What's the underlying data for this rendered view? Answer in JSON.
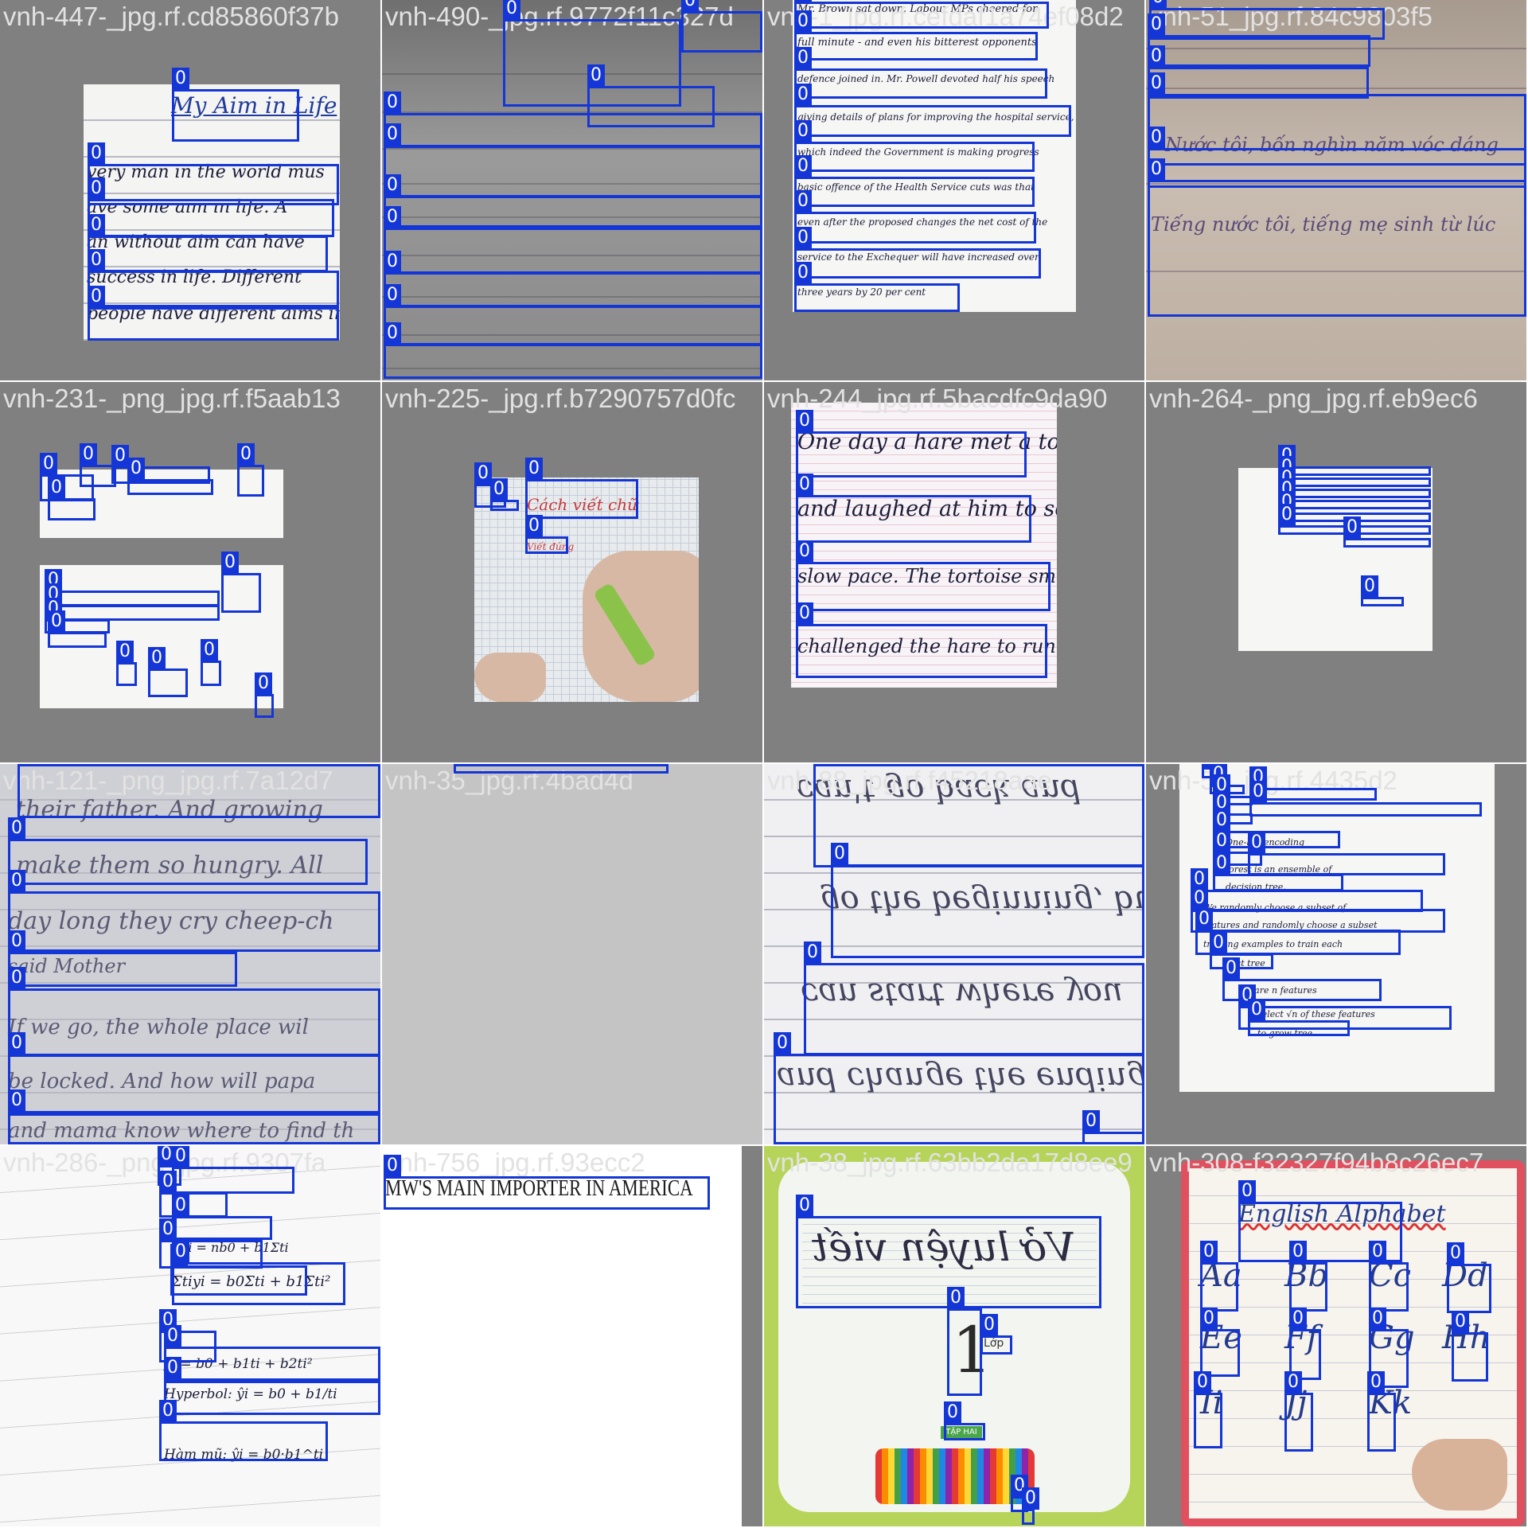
{
  "mosaic": {
    "class_label": "0",
    "tiles": [
      {
        "filename": "vnh-447-_jpg.rf.cd85860f37b",
        "title": "My Aim in Life",
        "lines": [
          "very man in the world mus",
          "ave some aim in life. A",
          "an without aim can have",
          "success in life. Different",
          "people have different aims in"
        ]
      },
      {
        "filename": "vnh-490-_jpg.rf.9772f11c327d",
        "lines": []
      },
      {
        "filename": "vnh-1_jpg.rf.cefdaf1a74ef08d2",
        "lines": [
          "Mr. Brown sat down. Labour MPs cheered for",
          "full minute - and even his bitterest opponents",
          "defence joined in. Mr. Powell devoted half his speech",
          "giving details of plans for improving the hospital service,",
          "which indeed the Government is making progress",
          "basic offence of the Health Service cuts was that",
          "even after the proposed changes the net cost of the",
          "service to the Exchequer will have increased over",
          "three years by 20 per cent"
        ]
      },
      {
        "filename": "vnh-51_jpg.rf.84c9803f5",
        "lines": [
          "Nước tôi, bốn nghìn năm vóc dáng",
          "Tiếng nước tôi, tiếng mẹ sinh từ lúc"
        ]
      },
      {
        "filename": "vnh-231-_png_jpg.rf.f5aab13",
        "lines": []
      },
      {
        "filename": "vnh-225-_jpg.rf.b7290757d0fc",
        "lines": [
          "Cách viết chữ",
          "Viết đúng"
        ]
      },
      {
        "filename": "vnh-244_jpg.rf.5bacdfc9da90",
        "lines": [
          "One day a hare met a tortoise",
          "and laughed at him to see his",
          "slow pace. The tortoise smiled and",
          "challenged the hare to run a race."
        ]
      },
      {
        "filename": "vnh-264-_png_jpg.rf.eb9ec6",
        "lines": []
      },
      {
        "filename": "vnh-121-_png_jpg.rf.7a12d7",
        "lines": [
          "their father. And growing",
          "make them so hungry. All",
          "day long they cry cheep-ch",
          "said Mother",
          "If we go, the whole place wil",
          "be locked. And how will papa",
          "and mama know where to find th"
        ]
      },
      {
        "filename": "vnh-35_jpg.rf.4bad4d",
        "lines": []
      },
      {
        "filename": "vnh-88_jpg.rf.f45218aae",
        "lines": [
          "can't go back and",
          "go the beginning, but",
          "can start where you",
          "and change the ending."
        ]
      },
      {
        "filename": "vnh-50_jpg.rf.4435d2",
        "lines": [
          "One-hot encoding",
          "forest is an ensemble of",
          "decision tree.",
          "We randomly choose a subset of",
          "features and randomly choose a subset",
          "training examples to train each",
          "best tree",
          "k are n features",
          "select √n of these features",
          "to grow tree"
        ]
      },
      {
        "filename": "vnh-286-_png_jpg.rf.9307fa",
        "lines": [
          "Σyi = nb0 + b1Σti",
          "Σtiyi = b0Σti + b1Σti²",
          "ŷi = b0 + b1ti + b2ti²",
          "Hyperbol: ŷi = b0 + b1/ti",
          "Hàm mũ: ŷi = b0·b1^ti"
        ]
      },
      {
        "filename": "vnh-756_jpg.rf.93ecc2",
        "lines": [
          "MW'S MAIN IMPORTER IN AMERICA"
        ]
      },
      {
        "filename": "vnh-38_jpg.rf.63bb2da17d8ee9",
        "lines": [
          "Vở luyện viết",
          "1",
          "Lớp",
          "TẬP HAI"
        ]
      },
      {
        "filename": "vnh-308-f32327f94b8c26ec7",
        "title": "English Alphabet",
        "lines": [
          "Aa",
          "Bb",
          "Cc",
          "Dd",
          "Ee",
          "Ff",
          "Gg",
          "Hh",
          "Ii",
          "Jj",
          "Kk"
        ]
      }
    ]
  }
}
